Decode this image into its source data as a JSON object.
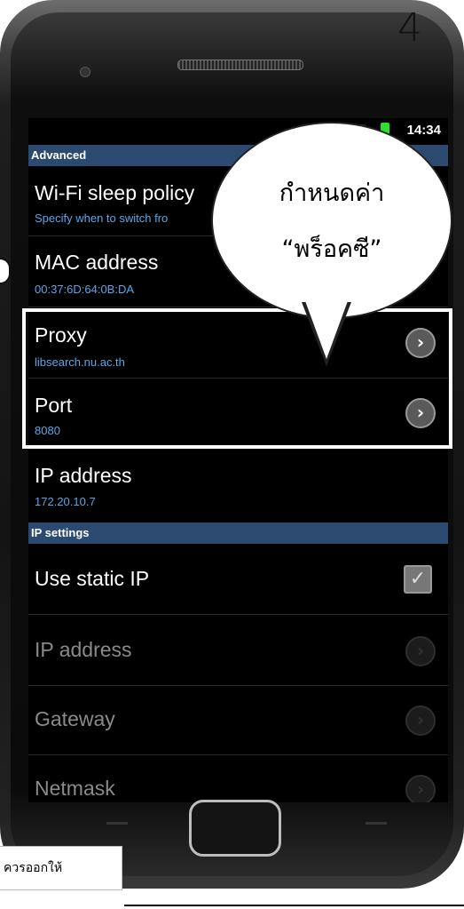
{
  "page_number": "4",
  "status": {
    "time": "14:34"
  },
  "sections": {
    "advanced": "Advanced",
    "ip_settings": "IP settings"
  },
  "items": {
    "wifi_sleep": {
      "title": "Wi-Fi sleep policy",
      "sub": "Specify when to switch fro"
    },
    "mac": {
      "title": "MAC address",
      "sub": "00:37:6D:64:0B:DA"
    },
    "proxy": {
      "title": "Proxy",
      "sub": "libsearch.nu.ac.th"
    },
    "port": {
      "title": "Port",
      "sub": "8080"
    },
    "ip_address": {
      "title": "IP address",
      "sub": "172.20.10.7"
    },
    "use_static_ip": {
      "title": "Use static IP",
      "checked": true
    },
    "static_ip_address": {
      "title": "IP address"
    },
    "gateway": {
      "title": "Gateway"
    },
    "netmask": {
      "title": "Netmask"
    }
  },
  "callout": {
    "line1": "กำหนดค่า",
    "line2": "“พร็อคซี”"
  },
  "caption": "ควรออกให้",
  "icons": [
    "chevron-right-icon",
    "check-icon",
    "battery-icon",
    "signal-icon",
    "wifi-icon"
  ],
  "colors": {
    "section_header": "#2c4a70",
    "subtitle": "#5aa7e8",
    "battery": "#2ee02e"
  }
}
